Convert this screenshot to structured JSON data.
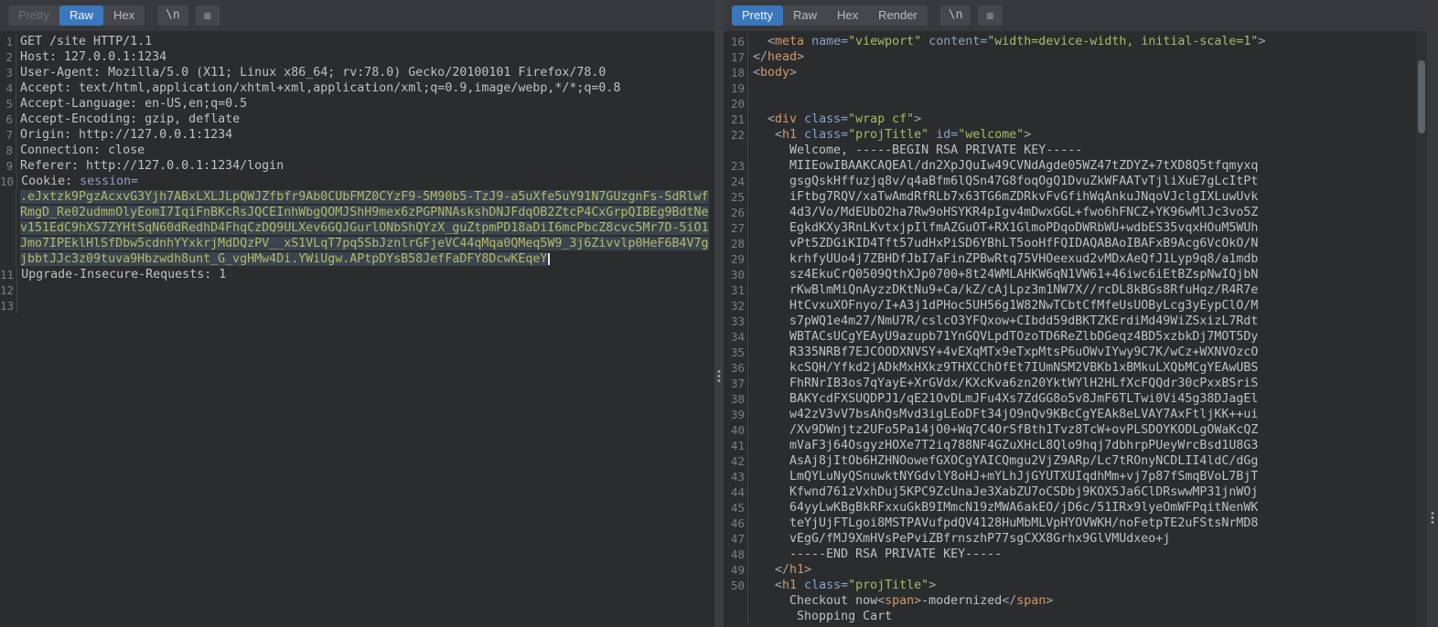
{
  "colors": {
    "accent_tab": "#3a78bd",
    "selection_bg": "#3a454f",
    "selection_text": "#b5ba67",
    "tag": "#d19a66",
    "attribute": "#8ba3c7",
    "string": "#a8bd63",
    "editor_bg": "#2a2c2e"
  },
  "left_panel": {
    "tabs": [
      {
        "label": "Pretty",
        "state": "disabled"
      },
      {
        "label": "Raw",
        "state": "active"
      },
      {
        "label": "Hex",
        "state": "normal"
      }
    ],
    "newline_button": "\\n",
    "menu_icon": "≡",
    "rows": [
      {
        "n": "1",
        "seg": [
          [
            "GET /site HTTP/1.1",
            "pln"
          ]
        ]
      },
      {
        "n": "2",
        "seg": [
          [
            "Host: 127.0.0.1:1234",
            "pln"
          ]
        ]
      },
      {
        "n": "3",
        "seg": [
          [
            "User-Agent: Mozilla/5.0 (X11; Linux x86_64; rv:78.0) Gecko/20100101 Firefox/78.0",
            "pln"
          ]
        ]
      },
      {
        "n": "4",
        "seg": [
          [
            "Accept: text/html,application/xhtml+xml,application/xml;q=0.9,image/webp,*/*;q=0.8",
            "pln"
          ]
        ]
      },
      {
        "n": "5",
        "seg": [
          [
            "Accept-Language: en-US,en;q=0.5",
            "pln"
          ]
        ]
      },
      {
        "n": "6",
        "seg": [
          [
            "Accept-Encoding: gzip, deflate",
            "pln"
          ]
        ]
      },
      {
        "n": "7",
        "seg": [
          [
            "Origin: http://127.0.0.1:1234",
            "pln"
          ]
        ]
      },
      {
        "n": "8",
        "seg": [
          [
            "Connection: close",
            "pln"
          ]
        ]
      },
      {
        "n": "9",
        "seg": [
          [
            "Referer: http://127.0.0.1:1234/login",
            "pln"
          ]
        ]
      },
      {
        "n": "10",
        "seg": [
          [
            "Cookie: ",
            "pln"
          ],
          [
            "session=",
            "ck"
          ]
        ]
      },
      {
        "n": "",
        "seg": [
          [
            ".eJxtzk9PgzAcxvG3Yjh7ABxLXLJLpQWJZfbfr9Ab0CUbFMZ0CYzF9-5M90b5-TzJ9-a5uXfe5uY91N7GUzgnFs-SdRlwf",
            "sel"
          ]
        ]
      },
      {
        "n": "",
        "seg": [
          [
            "RmgD_Re02udmmOlyEomI7IqiFnBKcRsJQCEInhWbgQOMJShH9mex6zPGPNNAskshDNJFdqOB2ZtcP4CxGrpQIBEg9BdtNe",
            "sel"
          ]
        ]
      },
      {
        "n": "",
        "seg": [
          [
            "v151EdC9hXS7ZYHtSqN60dRedhD4FhqCzDQ9ULXev6GQJGurlONbShQYzX_guZtpmPD18aDiI6mcPbcZ8cvc5Mr7D-5iO1",
            "sel"
          ]
        ]
      },
      {
        "n": "",
        "seg": [
          [
            "Jmo7IPEklHlSfDbw5cdnhYYxkrjMdDQzPV__xS1VLqT7pq5SbJznlrGFjeVC44qMqa0QMeq5W9_3j6Zivvlp0HeF6B4V7g",
            "sel"
          ]
        ]
      },
      {
        "n": "",
        "seg": [
          [
            "jbbtJJc3z09tuva9Hbzwdh8unt_G_vgHMw4Di.YWiUgw.APtpDYsB58JefFaDFY8DcwKEqeY",
            "sel"
          ]
        ],
        "cursor": true
      },
      {
        "n": "11",
        "seg": [
          [
            "Upgrade-Insecure-Requests: 1",
            "pln"
          ]
        ]
      },
      {
        "n": "12",
        "seg": []
      },
      {
        "n": "13",
        "seg": []
      }
    ]
  },
  "right_panel": {
    "tabs": [
      {
        "label": "Pretty",
        "state": "active"
      },
      {
        "label": "Raw",
        "state": "normal"
      },
      {
        "label": "Hex",
        "state": "normal"
      },
      {
        "label": "Render",
        "state": "normal"
      }
    ],
    "newline_button": "\\n",
    "menu_icon": "≡",
    "rows": [
      {
        "n": "16",
        "seg": [
          [
            "  ",
            "pln"
          ],
          [
            "<",
            "brk"
          ],
          [
            "meta",
            "tag"
          ],
          [
            " ",
            "pln"
          ],
          [
            "name=",
            "att"
          ],
          [
            "\"viewport\"",
            "str"
          ],
          [
            " ",
            "pln"
          ],
          [
            "content=",
            "att"
          ],
          [
            "\"width=device-width, initial-scale=1\"",
            "str"
          ],
          [
            ">",
            "brk"
          ]
        ]
      },
      {
        "n": "17",
        "seg": [
          [
            "</",
            "brk"
          ],
          [
            "head",
            "tag"
          ],
          [
            ">",
            "brk"
          ]
        ]
      },
      {
        "n": "18",
        "seg": [
          [
            "<",
            "brk"
          ],
          [
            "body",
            "tag"
          ],
          [
            ">",
            "brk"
          ]
        ]
      },
      {
        "n": "19",
        "seg": []
      },
      {
        "n": "20",
        "seg": []
      },
      {
        "n": "21",
        "seg": [
          [
            "  ",
            "pln"
          ],
          [
            "<",
            "brk"
          ],
          [
            "div",
            "tag"
          ],
          [
            " ",
            "pln"
          ],
          [
            "class=",
            "att"
          ],
          [
            "\"wrap cf\"",
            "str"
          ],
          [
            ">",
            "brk"
          ]
        ]
      },
      {
        "n": "22",
        "seg": [
          [
            "   ",
            "pln"
          ],
          [
            "<",
            "brk"
          ],
          [
            "h1",
            "tag"
          ],
          [
            " ",
            "pln"
          ],
          [
            "class=",
            "att"
          ],
          [
            "\"projTitle\"",
            "str"
          ],
          [
            " ",
            "pln"
          ],
          [
            "id=",
            "att"
          ],
          [
            "\"welcome\"",
            "str"
          ],
          [
            ">",
            "brk"
          ]
        ]
      },
      {
        "n": "",
        "seg": [
          [
            "     Welcome, -----BEGIN RSA PRIVATE KEY-----",
            "pln"
          ]
        ]
      },
      {
        "n": "23",
        "seg": [
          [
            "     MIIEowIBAAKCAQEAl/dn2XpJQuIw49CVNdAgde05WZ47tZDYZ+7tXD8Q5tfqmyxq",
            "pln"
          ]
        ]
      },
      {
        "n": "24",
        "seg": [
          [
            "     gsgQskHffuzjq8v/q4aBfm6lQSn47G8foqOgQ1DvuZkWFAATvTjliXuE7gLcItPt",
            "pln"
          ]
        ]
      },
      {
        "n": "25",
        "seg": [
          [
            "     iFtbg7RQV/xaTwAmdRfRLb7x63TG6mZDRkvFvGfihWqAnkuJNqoVJclgIXLuwUvk",
            "pln"
          ]
        ]
      },
      {
        "n": "26",
        "seg": [
          [
            "     4d3/Vo/MdEUbO2ha7Rw9oHSYKR4pIgv4mDwxGGL+fwo6hFNCZ+YK96wMlJc3vo5Z",
            "pln"
          ]
        ]
      },
      {
        "n": "27",
        "seg": [
          [
            "     EgkdKXy3RnLKvtxjpIlfmAZGuOT+RX1GlmoPDqoDWRbWU+wdbES35vqxHOuM5WUh",
            "pln"
          ]
        ]
      },
      {
        "n": "28",
        "seg": [
          [
            "     vPt5ZDGiKID4Tft57udHxPiSD6YBhLT5ooHfFQIDAQABAoIBAFxB9Acg6VcOkO/N",
            "pln"
          ]
        ]
      },
      {
        "n": "29",
        "seg": [
          [
            "     krhfyUUo4j7ZBHDfJbI7aFinZPBwRtq75VHOeexud2vMDxAeQfJ1Lyp9q8/a1mdb",
            "pln"
          ]
        ]
      },
      {
        "n": "30",
        "seg": [
          [
            "     sz4EkuCrQ0509QthXJp0700+8t24WMLAHKW6qN1VW61+46iwc6iEtBZspNwIQjbN",
            "pln"
          ]
        ]
      },
      {
        "n": "31",
        "seg": [
          [
            "     rKwBlmMiQnAyzzDKtNu9+Ca/kZ/cAjLpz3m1NW7X//rcDL8kBGs8RfuHqz/R4R7e",
            "pln"
          ]
        ]
      },
      {
        "n": "32",
        "seg": [
          [
            "     HtCvxuXOFnyo/I+A3j1dPHoc5UH56g1W82NwTCbtCfMfeUsUOByLcg3yEypClO/M",
            "pln"
          ]
        ]
      },
      {
        "n": "33",
        "seg": [
          [
            "     s7pWQ1e4m27/NmU7R/cslcO3YFQxow+CIbdd59dBKTZKErdiMd49WiZSxizL7Rdt",
            "pln"
          ]
        ]
      },
      {
        "n": "34",
        "seg": [
          [
            "     WBTACsUCgYEAyU9azupb71YnGQVLpdTOzoTD6ReZlbDGeqz4BD5xzbkDj7MOT5Dy",
            "pln"
          ]
        ]
      },
      {
        "n": "35",
        "seg": [
          [
            "     R335NRBf7EJCOODXNVSY+4vEXqMTx9eTxpMtsP6uOWvIYwy9C7K/wCz+WXNVOzcO",
            "pln"
          ]
        ]
      },
      {
        "n": "36",
        "seg": [
          [
            "     kcSQH/Yfkd2jADkMxHXkz9THXCChOfEt7IUmNSM2VBKb1xBMkuLXQbMCgYEAwUBS",
            "pln"
          ]
        ]
      },
      {
        "n": "37",
        "seg": [
          [
            "     FhRNrIB3os7qYayE+XrGVdx/KXcKva6zn20YktWYlH2HLfXcFQQdr30cPxxBSriS",
            "pln"
          ]
        ]
      },
      {
        "n": "38",
        "seg": [
          [
            "     BAKYcdFXSUQDPJ1/qE21OvDLmJFu4Xs7ZdGG8o5v8JmF6TLTwi0Vi45g38DJagEl",
            "pln"
          ]
        ]
      },
      {
        "n": "39",
        "seg": [
          [
            "     w42zV3vV7bsAhQsMvd3igLEoDFt34jO9nQv9KBcCgYEAk8eLVAY7AxFtljKK++ui",
            "pln"
          ]
        ]
      },
      {
        "n": "40",
        "seg": [
          [
            "     /Xv9DWnjtz2UFo5Pa14jO0+Wq7C4OrSfBth1Tvz8TcW+ovPLSDOYKODLgOWaKcQZ",
            "pln"
          ]
        ]
      },
      {
        "n": "41",
        "seg": [
          [
            "     mVaF3j64OsgyzHOXe7T2iq788NF4GZuXHcL8Qlo9hqj7dbhrpPUeyWrcBsd1U8G3",
            "pln"
          ]
        ]
      },
      {
        "n": "42",
        "seg": [
          [
            "     AsAj8jItOb6HZHNOowefGXOCgYAICQmgu2VjZ9ARp/Lc7tROnyNCDLII4ldC/dGg",
            "pln"
          ]
        ]
      },
      {
        "n": "43",
        "seg": [
          [
            "     LmQYLuNyQSnuwktNYGdvlY8oHJ+mYLhJjGYUTXUIqdhMm+vj7p87fSmqBVoL7BjT",
            "pln"
          ]
        ]
      },
      {
        "n": "44",
        "seg": [
          [
            "     Kfwnd761zVxhDuj5KPC9ZcUnaJe3XabZU7oCSDbj9KOX5Ja6ClDRswwMP31jnWOj",
            "pln"
          ]
        ]
      },
      {
        "n": "45",
        "seg": [
          [
            "     64yyLwKBgBkRFxxuGkB9IMmcN19zMWA6akEO/jD6c/51IRx9lyeOmWFPqitNenWK",
            "pln"
          ]
        ]
      },
      {
        "n": "46",
        "seg": [
          [
            "     teYjUjFTLgoi8MSTPAVufpdQV4128HuMbMLVpHYOVWKH/noFetpTE2uFStsNrMD8",
            "pln"
          ]
        ]
      },
      {
        "n": "47",
        "seg": [
          [
            "     vEgG/fMJ9XmHVsPePviZBfrnszhP77sgCXX8Grhx9GlVMUdxeo+j",
            "pln"
          ]
        ]
      },
      {
        "n": "48",
        "seg": [
          [
            "     -----END RSA PRIVATE KEY-----",
            "pln"
          ]
        ]
      },
      {
        "n": "49",
        "seg": [
          [
            "   ",
            "pln"
          ],
          [
            "</",
            "brk"
          ],
          [
            "h1",
            "tag"
          ],
          [
            ">",
            "brk"
          ]
        ]
      },
      {
        "n": "50",
        "seg": [
          [
            "   ",
            "pln"
          ],
          [
            "<",
            "brk"
          ],
          [
            "h1",
            "tag"
          ],
          [
            " ",
            "pln"
          ],
          [
            "class=",
            "att"
          ],
          [
            "\"projTitle\"",
            "str"
          ],
          [
            ">",
            "brk"
          ]
        ]
      },
      {
        "n": "",
        "seg": [
          [
            "     Checkout now",
            "pln"
          ],
          [
            "<",
            "brk"
          ],
          [
            "span",
            "tag"
          ],
          [
            ">",
            "brk"
          ],
          [
            "-modernized",
            "pln"
          ],
          [
            "</",
            "brk"
          ],
          [
            "span",
            "tag"
          ],
          [
            ">",
            "brk"
          ]
        ]
      },
      {
        "n": "",
        "seg": [
          [
            "      Shopping Cart",
            "pln"
          ]
        ]
      }
    ]
  }
}
